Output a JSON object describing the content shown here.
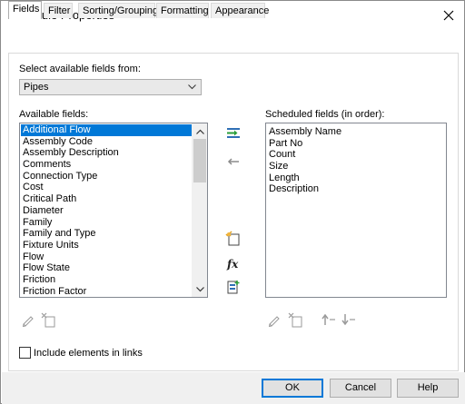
{
  "window": {
    "title": "Schedule Properties"
  },
  "tabs": [
    {
      "label": "Fields"
    },
    {
      "label": "Filter"
    },
    {
      "label": "Sorting/Grouping"
    },
    {
      "label": "Formatting"
    },
    {
      "label": "Appearance"
    }
  ],
  "fields_tab": {
    "select_from_label": "Select available fields from:",
    "category_value": "Pipes",
    "available_label": "Available fields:",
    "available_fields": [
      "Additional Flow",
      "Assembly Code",
      "Assembly Description",
      "Comments",
      "Connection Type",
      "Cost",
      "Critical Path",
      "Diameter",
      "Family",
      "Family and Type",
      "Fixture Units",
      "Flow",
      "Flow State",
      "Friction",
      "Friction Factor"
    ],
    "scheduled_label": "Scheduled fields (in order):",
    "scheduled_fields": [
      "Assembly Name",
      "Part No",
      "Count",
      "Size",
      "Length",
      "Description"
    ],
    "include_links_label": "Include elements in links",
    "include_links_checked": false
  },
  "buttons": {
    "ok": "OK",
    "cancel": "Cancel",
    "help": "Help"
  },
  "colors": {
    "selection": "#0078d7",
    "add_arrow": "#2a9d3a",
    "accent": "#2f6fb5"
  },
  "icons": {
    "add": "add-parameter-icon",
    "remove": "remove-parameter-icon",
    "new_param": "new-parameter-icon",
    "calc": "calculated-value-icon",
    "combine": "combine-parameters-icon",
    "edit": "edit-parameter-icon",
    "delete": "delete-parameter-icon",
    "up": "move-up-icon",
    "down": "move-down-icon"
  }
}
